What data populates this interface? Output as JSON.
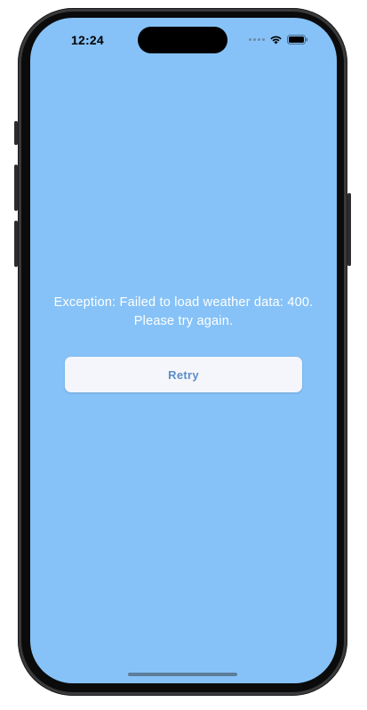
{
  "status_bar": {
    "time": "12:24"
  },
  "error": {
    "message": "Exception: Failed to load weather data: 400. Please try again."
  },
  "actions": {
    "retry_label": "Retry"
  },
  "colors": {
    "screen_background": "#86c2f7",
    "button_background": "#f4f6fb",
    "button_text": "#5b8dc9",
    "message_text": "#ffffff"
  },
  "icons": [
    "signal-dots-icon",
    "wifi-icon",
    "battery-icon"
  ]
}
